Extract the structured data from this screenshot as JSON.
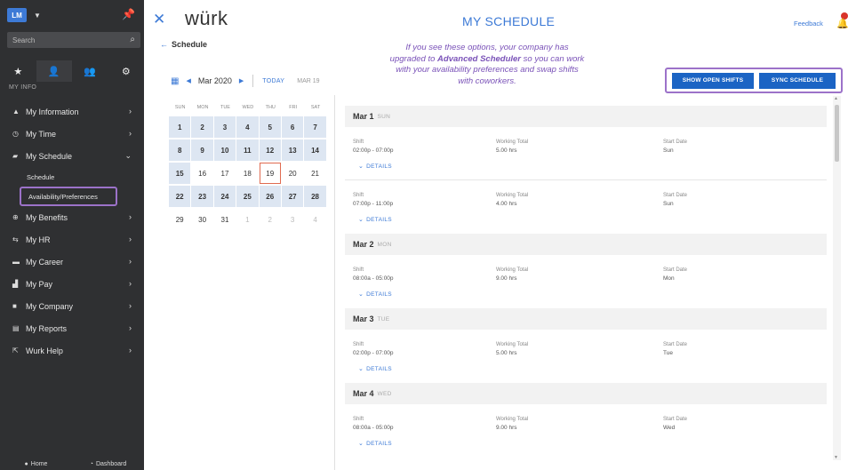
{
  "sidebar": {
    "avatar": "LM",
    "search_placeholder": "Search",
    "section_label": "MY INFO",
    "items": [
      {
        "label": "My Information",
        "icon": "person-icon"
      },
      {
        "label": "My Time",
        "icon": "clock-icon"
      },
      {
        "label": "My Schedule",
        "icon": "car-icon",
        "expanded": true
      },
      {
        "label": "My Benefits",
        "icon": "plus-circle-icon"
      },
      {
        "label": "My HR",
        "icon": "people-icon"
      },
      {
        "label": "My Career",
        "icon": "briefcase-icon"
      },
      {
        "label": "My Pay",
        "icon": "money-icon"
      },
      {
        "label": "My Company",
        "icon": "building-icon"
      },
      {
        "label": "My Reports",
        "icon": "report-icon"
      },
      {
        "label": "Wurk Help",
        "icon": "external-link-icon"
      }
    ],
    "subitems": [
      "Schedule",
      "Availability/Preferences"
    ],
    "bottom": {
      "home": "Home",
      "dashboard": "Dashboard"
    }
  },
  "header": {
    "logo": "würk",
    "title": "MY SCHEDULE",
    "feedback": "Feedback",
    "back_label": "Schedule"
  },
  "note": {
    "line1": "If you see these options, your company has",
    "line2_pre": "upgraded to ",
    "line2_bold": "Advanced Scheduler",
    "line2_post": " so you can work",
    "line3": "with your availability preferences and swap shifts",
    "line4": "with coworkers."
  },
  "buttons": {
    "open_shifts": "SHOW OPEN SHIFTS",
    "sync": "SYNC SCHEDULE"
  },
  "calendar": {
    "month": "Mar 2020",
    "today_label": "TODAY",
    "current_date": "MAR 19",
    "weekdays": [
      "SUN",
      "MON",
      "TUE",
      "WED",
      "THU",
      "FRI",
      "SAT"
    ],
    "weeks": [
      [
        {
          "d": "1",
          "t": "shift"
        },
        {
          "d": "2",
          "t": "shift"
        },
        {
          "d": "3",
          "t": "shift"
        },
        {
          "d": "4",
          "t": "shift"
        },
        {
          "d": "5",
          "t": "shift"
        },
        {
          "d": "6",
          "t": "shift"
        },
        {
          "d": "7",
          "t": "shift"
        }
      ],
      [
        {
          "d": "8",
          "t": "shift"
        },
        {
          "d": "9",
          "t": "shift"
        },
        {
          "d": "10",
          "t": "shift"
        },
        {
          "d": "11",
          "t": "shift"
        },
        {
          "d": "12",
          "t": "shift"
        },
        {
          "d": "13",
          "t": "shift"
        },
        {
          "d": "14",
          "t": "shift"
        }
      ],
      [
        {
          "d": "15",
          "t": "shift"
        },
        {
          "d": "16",
          "t": ""
        },
        {
          "d": "17",
          "t": ""
        },
        {
          "d": "18",
          "t": ""
        },
        {
          "d": "19",
          "t": "today"
        },
        {
          "d": "20",
          "t": ""
        },
        {
          "d": "21",
          "t": ""
        }
      ],
      [
        {
          "d": "22",
          "t": "shift"
        },
        {
          "d": "23",
          "t": "shift"
        },
        {
          "d": "24",
          "t": "shift"
        },
        {
          "d": "25",
          "t": "shift"
        },
        {
          "d": "26",
          "t": "shift"
        },
        {
          "d": "27",
          "t": "shift"
        },
        {
          "d": "28",
          "t": "shift"
        }
      ],
      [
        {
          "d": "29",
          "t": ""
        },
        {
          "d": "30",
          "t": ""
        },
        {
          "d": "31",
          "t": ""
        },
        {
          "d": "1",
          "t": "muted"
        },
        {
          "d": "2",
          "t": "muted"
        },
        {
          "d": "3",
          "t": "muted"
        },
        {
          "d": "4",
          "t": "muted"
        }
      ]
    ]
  },
  "schedule": {
    "labels": {
      "shift": "Shift",
      "working_total": "Working Total",
      "start_date": "Start Date",
      "details": "DETAILS"
    },
    "days": [
      {
        "date": "Mar 1",
        "dow": "SUN",
        "entries": [
          {
            "shift": "02:00p - 07:00p",
            "total": "5.00 hrs",
            "start": "Sun"
          },
          {
            "shift": "07:00p - 11:00p",
            "total": "4.00 hrs",
            "start": "Sun"
          }
        ]
      },
      {
        "date": "Mar 2",
        "dow": "MON",
        "entries": [
          {
            "shift": "08:00a - 05:00p",
            "total": "9.00 hrs",
            "start": "Mon"
          }
        ]
      },
      {
        "date": "Mar 3",
        "dow": "TUE",
        "entries": [
          {
            "shift": "02:00p - 07:00p",
            "total": "5.00 hrs",
            "start": "Tue"
          }
        ]
      },
      {
        "date": "Mar 4",
        "dow": "WED",
        "entries": [
          {
            "shift": "08:00a - 05:00p",
            "total": "9.00 hrs",
            "start": "Wed"
          }
        ]
      }
    ]
  },
  "colors": {
    "accent": "#3d7ad6",
    "sidebar": "#2f3032",
    "highlight": "#9c72c9",
    "button": "#1b64c4",
    "note": "#7a52b8"
  }
}
